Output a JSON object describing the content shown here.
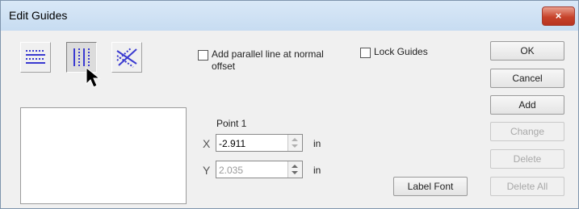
{
  "window": {
    "title": "Edit Guides",
    "close_glyph": "×"
  },
  "mode_buttons": [
    {
      "icon": "horizontal-lines-icon",
      "state": "raised"
    },
    {
      "icon": "vertical-lines-icon",
      "state": "pressed"
    },
    {
      "icon": "angled-lines-icon",
      "state": "raised"
    }
  ],
  "options": {
    "parallel_line_label_1": "Add parallel line at normal",
    "parallel_line_label_2": "offset",
    "parallel_line_checked": false,
    "lock_guides_label": "Lock Guides",
    "lock_guides_checked": false
  },
  "point": {
    "heading": "Point 1",
    "x_label": "X",
    "x_value": "-2.911",
    "x_unit": "in",
    "y_label": "Y",
    "y_value": "2.035",
    "y_unit": "in"
  },
  "buttons": {
    "ok": "OK",
    "cancel": "Cancel",
    "add": "Add",
    "change": "Change",
    "delete": "Delete",
    "delete_all": "Delete All",
    "label_font": "Label Font"
  },
  "colors": {
    "icon_blue": "#3a3ad0",
    "close_red": "#c7432b"
  }
}
